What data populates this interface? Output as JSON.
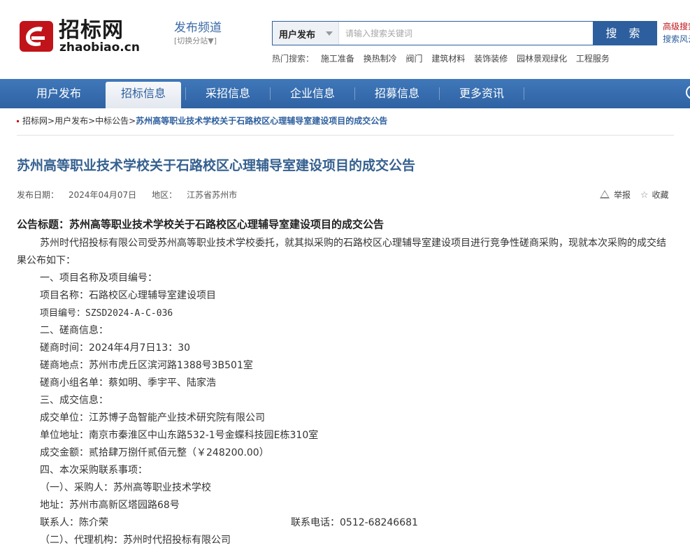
{
  "header": {
    "logo_cn": "招标网",
    "logo_en": "zhaobiao.cn",
    "channel_title": "发布频道",
    "channel_switch": "[切换分站▼]",
    "search_type": "用户发布",
    "search_placeholder": "请输入搜索关键词",
    "search_button": "搜 索",
    "advanced_search": "高级搜索",
    "search_tips": "搜索风云",
    "hot_label": "热门搜索：",
    "hot_items": [
      "施工准备",
      "换热制冷",
      "阀门",
      "建筑材料",
      "装饰装修",
      "园林景观绿化",
      "工程服务"
    ]
  },
  "nav": {
    "items": [
      {
        "label": "用户发布"
      },
      {
        "label": "招标信息"
      },
      {
        "label": "采招信息"
      },
      {
        "label": "企业信息"
      },
      {
        "label": "招募信息"
      },
      {
        "label": "更多资讯"
      }
    ],
    "active": "招标信息"
  },
  "breadcrumb": {
    "items": [
      "招标网",
      "用户发布",
      "中标公告"
    ],
    "separator": ">",
    "current": "苏州高等职业技术学校关于石路校区心理辅导室建设项目的成交公告"
  },
  "article": {
    "title": "苏州高等职业技术学校关于石路校区心理辅导室建设项目的成交公告",
    "date_label": "发布日期：",
    "date": "2024年04月07日",
    "region_label": "地区：",
    "region": "江苏省苏州市",
    "report_label": "举报",
    "favorite_label": "收藏",
    "notice_title": "公告标题：苏州高等职业技术学校关于石路校区心理辅导室建设项目的成交公告",
    "intro": "苏州时代招投标有限公司受苏州高等职业技术学校委托，就其拟采购的石路校区心理辅导室建设项目进行竞争性磋商采购，现就本次采购的成交结果公布如下：",
    "lines": [
      "一、项目名称及项目编号：",
      "项目名称：石路校区心理辅导室建设项目",
      "项目编号：SZSD2024-A-C-036",
      "二、磋商信息：",
      "磋商时间：2024年4月7日13：30",
      "磋商地点：苏州市虎丘区滨河路1388号3B501室",
      "磋商小组名单：蔡如明、季宇平、陆家浩",
      "三、成交信息：",
      "成交单位：江苏博子岛智能产业技术研究院有限公司",
      "单位地址：南京市秦淮区中山东路532-1号金蝶科技园E栋310室",
      "成交金额：贰拾肆万捌仟贰佰元整（￥248200.00）",
      "四、本次采购联系事项：",
      "（一）、采购人：苏州高等职业技术学校",
      "地址：苏州市高新区塔园路68号"
    ],
    "contact_person": "联系人：陈介荣",
    "contact_phone": "联系电话：0512-68246681",
    "agency_line": "（二）、代理机构：苏州时代招投标有限公司"
  },
  "colors": {
    "brand_blue": "#2d5f9e",
    "nav_blue": "#3a70b2",
    "title_blue": "#35608f",
    "logo_red": "#c0141a"
  }
}
